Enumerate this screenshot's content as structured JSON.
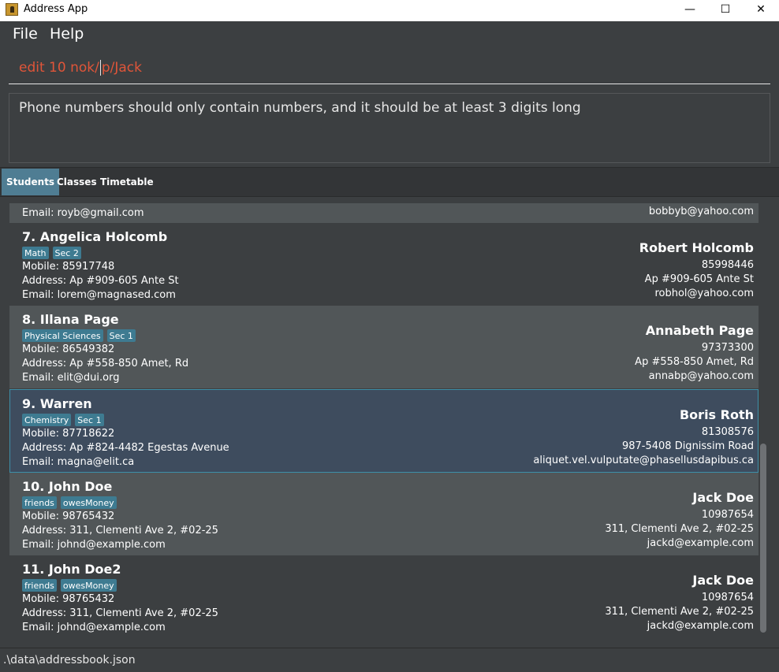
{
  "window": {
    "title": "Address App",
    "minimize": "—",
    "maximize": "☐",
    "close": "✕"
  },
  "menu": {
    "file": "File",
    "help": "Help"
  },
  "command": {
    "before_caret": "edit 10 nok/",
    "after_caret": "p/Jack"
  },
  "result": {
    "message": "Phone numbers should only contain numbers, and it should be at least 3 digits long"
  },
  "tabs": [
    {
      "label": "Students"
    },
    {
      "label": "Classes"
    },
    {
      "label": "Timetable"
    }
  ],
  "partial_card": {
    "email": "Email: royb@gmail.com",
    "nok_email": "bobbyb@yahoo.com"
  },
  "students": [
    {
      "name": "7.  Angelica Holcomb",
      "tags": [
        "Math",
        "Sec 2"
      ],
      "mobile": "Mobile: 85917748",
      "address": "Address: Ap #909-605 Ante St",
      "email": "Email: lorem@magnased.com",
      "nok_name": "Robert Holcomb",
      "nok_phone": "85998446",
      "nok_address": "Ap #909-605 Ante St",
      "nok_email": "robhol@yahoo.com"
    },
    {
      "name": "8.  Illana Page",
      "tags": [
        "Physical Sciences",
        "Sec 1"
      ],
      "mobile": "Mobile: 86549382",
      "address": "Address: Ap #558-850 Amet, Rd",
      "email": "Email: elit@dui.org",
      "nok_name": "Annabeth Page",
      "nok_phone": "97373300",
      "nok_address": "Ap #558-850 Amet, Rd",
      "nok_email": "annabp@yahoo.com"
    },
    {
      "name": "9.  Warren",
      "tags": [
        "Chemistry",
        "Sec 1"
      ],
      "mobile": "Mobile: 87718622",
      "address": "Address: Ap #824-4482 Egestas Avenue",
      "email": "Email: magna@elit.ca",
      "nok_name": "Boris Roth",
      "nok_phone": "81308576",
      "nok_address": "987-5408 Dignissim Road",
      "nok_email": "aliquet.vel.vulputate@phasellusdapibus.ca"
    },
    {
      "name": "10.  John Doe",
      "tags": [
        "friends",
        "owesMoney"
      ],
      "mobile": "Mobile: 98765432",
      "address": "Address: 311, Clementi Ave 2, #02-25",
      "email": "Email: johnd@example.com",
      "nok_name": "Jack Doe",
      "nok_phone": "10987654",
      "nok_address": "311, Clementi Ave 2, #02-25",
      "nok_email": "jackd@example.com"
    },
    {
      "name": "11.  John Doe2",
      "tags": [
        "friends",
        "owesMoney"
      ],
      "mobile": "Mobile: 98765432",
      "address": "Address: 311, Clementi Ave 2, #02-25",
      "email": "Email: johnd@example.com",
      "nok_name": "Jack Doe",
      "nok_phone": "10987654",
      "nok_address": "311, Clementi Ave 2, #02-25",
      "nok_email": "jackd@example.com"
    }
  ],
  "status": {
    "path": ".\\data\\addressbook.json"
  },
  "colors": {
    "accent": "#4f7d93",
    "tag": "#3e7b91",
    "error_text": "#e05539",
    "selected_border": "#3d8fa8"
  }
}
